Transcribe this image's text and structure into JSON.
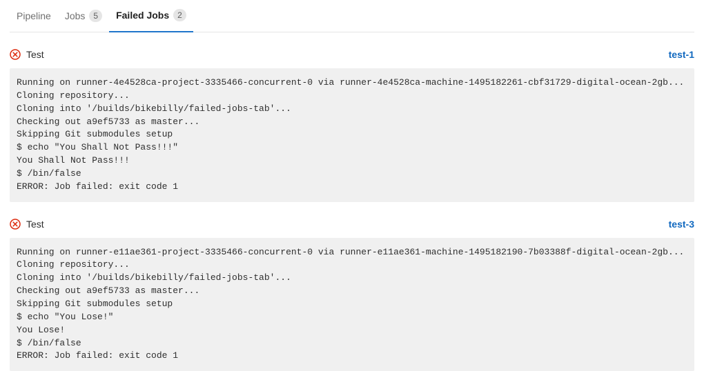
{
  "tabs": [
    {
      "label": "Pipeline",
      "count": null,
      "active": false
    },
    {
      "label": "Jobs",
      "count": "5",
      "active": false
    },
    {
      "label": "Failed Jobs",
      "count": "2",
      "active": true
    }
  ],
  "jobs": [
    {
      "stage": "Test",
      "name": "test-1",
      "log": "Running on runner-4e4528ca-project-3335466-concurrent-0 via runner-4e4528ca-machine-1495182261-cbf31729-digital-ocean-2gb...\nCloning repository...\nCloning into '/builds/bikebilly/failed-jobs-tab'...\nChecking out a9ef5733 as master...\nSkipping Git submodules setup\n$ echo \"You Shall Not Pass!!!\"\nYou Shall Not Pass!!!\n$ /bin/false\nERROR: Job failed: exit code 1"
    },
    {
      "stage": "Test",
      "name": "test-3",
      "log": "Running on runner-e11ae361-project-3335466-concurrent-0 via runner-e11ae361-machine-1495182190-7b03388f-digital-ocean-2gb...\nCloning repository...\nCloning into '/builds/bikebilly/failed-jobs-tab'...\nChecking out a9ef5733 as master...\nSkipping Git submodules setup\n$ echo \"You Lose!\"\nYou Lose!\n$ /bin/false\nERROR: Job failed: exit code 1"
    }
  ]
}
